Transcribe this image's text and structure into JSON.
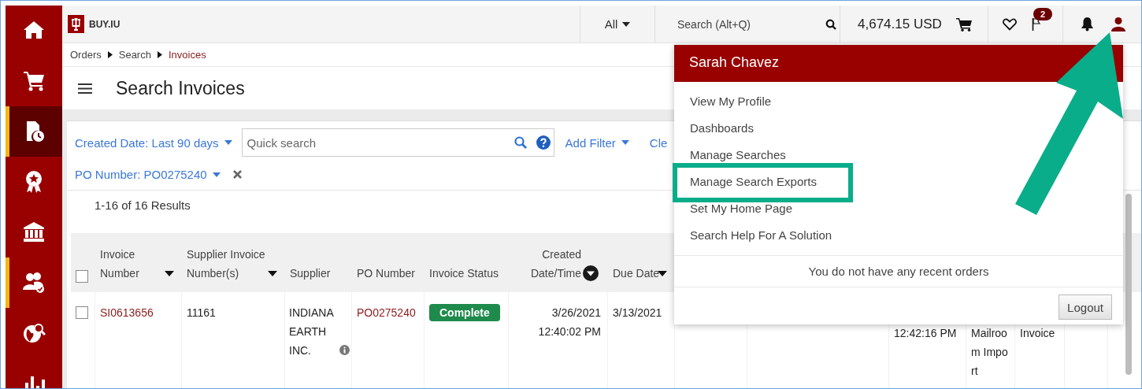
{
  "sidebar": {
    "items": [
      {
        "kind": "home",
        "selected": false,
        "flagged": false
      },
      {
        "kind": "cart",
        "selected": false,
        "flagged": false
      },
      {
        "kind": "invoice",
        "selected": true,
        "flagged": true
      },
      {
        "kind": "award",
        "selected": false,
        "flagged": false
      },
      {
        "kind": "bank",
        "selected": false,
        "flagged": false
      },
      {
        "kind": "people",
        "selected": false,
        "flagged": true
      },
      {
        "kind": "globe",
        "selected": false,
        "flagged": false
      },
      {
        "kind": "chart",
        "selected": false,
        "flagged": false
      }
    ]
  },
  "header": {
    "logo_text": "BUY.IU",
    "scope": "All",
    "search": {
      "placeholder": "Search (Alt+Q)"
    },
    "cart_total": "4,674.15 USD",
    "flag_count": "2"
  },
  "breadcrumb": [
    {
      "label": "Orders",
      "current": false
    },
    {
      "label": "Search",
      "current": false
    },
    {
      "label": "Invoices",
      "current": true
    }
  ],
  "page_title": "Search Invoices",
  "filters": {
    "date_filter": "Created Date: Last 90 days",
    "quick_search": {
      "placeholder": "Quick search"
    },
    "add_filter": "Add Filter",
    "clear": "Cle",
    "po_filter": "PO Number: PO0275240"
  },
  "results_count": "1-16 of 16 Results",
  "table": {
    "select_all": {
      "checked": false
    },
    "columns": [
      {
        "label": "Invoice Number",
        "kind": "sortable"
      },
      {
        "label": "Supplier Invoice Number(s)",
        "kind": "sortable"
      },
      {
        "label": "Supplier",
        "kind": "plain"
      },
      {
        "label": "PO Number",
        "kind": "plain"
      },
      {
        "label": "Invoice Status",
        "kind": "plain"
      },
      {
        "label": "Created Date/Time",
        "kind": "sorted"
      },
      {
        "label": "Due Date",
        "kind": "sortable"
      }
    ],
    "rows": [
      {
        "checked": false,
        "cells": [
          {
            "kind": "link",
            "text": "SI0613656"
          },
          {
            "kind": "text",
            "text": "11161"
          },
          {
            "kind": "info",
            "text": "INDIANA EARTH INC."
          },
          {
            "kind": "link",
            "text": "PO0275240"
          },
          {
            "kind": "badge",
            "text": "Complete"
          },
          {
            "kind": "right",
            "text": "3/26/2021 12:40:02 PM"
          },
          {
            "kind": "text",
            "text": "3/13/2021"
          },
          null,
          null,
          {
            "kind": "lower",
            "text": "12:42:16 PM"
          },
          {
            "kind": "lower",
            "text": "Mailroom Import"
          },
          {
            "kind": "lower",
            "text": "Invoice"
          },
          null
        ]
      }
    ]
  },
  "user_menu": {
    "name": "Sarah Chavez",
    "items": [
      {
        "label": "View My Profile",
        "annotated": false
      },
      {
        "label": "Dashboards",
        "annotated": false
      },
      {
        "label": "Manage Searches",
        "annotated": false
      },
      {
        "label": "Manage Search Exports",
        "annotated": true
      },
      {
        "label": "Set My Home Page",
        "annotated": false
      },
      {
        "label": "Search Help For A Solution",
        "annotated": false
      }
    ],
    "recent_orders_note": "You do not have any recent orders",
    "logout": "Logout"
  }
}
